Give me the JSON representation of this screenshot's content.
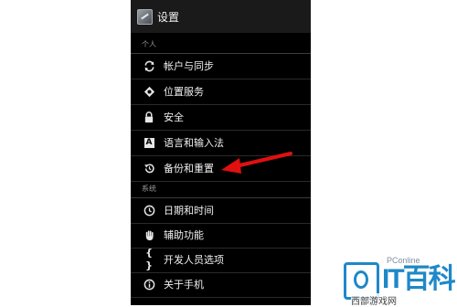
{
  "header": {
    "title": "设置"
  },
  "sections": {
    "personal": "个人",
    "system": "系统"
  },
  "personal_items": [
    {
      "label": "帐户与同步",
      "icon": "sync-icon"
    },
    {
      "label": "位置服务",
      "icon": "location-icon"
    },
    {
      "label": "安全",
      "icon": "lock-icon"
    },
    {
      "label": "语言和输入法",
      "icon": "language-icon"
    },
    {
      "label": "备份和重置",
      "icon": "backup-restore-icon"
    }
  ],
  "system_items": [
    {
      "label": "日期和时间",
      "icon": "clock-icon"
    },
    {
      "label": "辅助功能",
      "icon": "accessibility-hand-icon"
    },
    {
      "label": "开发人员选项",
      "icon": "braces-icon"
    },
    {
      "label": "关于手机",
      "icon": "info-icon"
    }
  ],
  "watermark": {
    "brand": "PConline",
    "big_text": "IT百科",
    "sub_text": "西部游戏网"
  },
  "colors": {
    "background": "#000000",
    "annotation_arrow": "#e01010",
    "watermark_blue": "#1e88c8"
  }
}
